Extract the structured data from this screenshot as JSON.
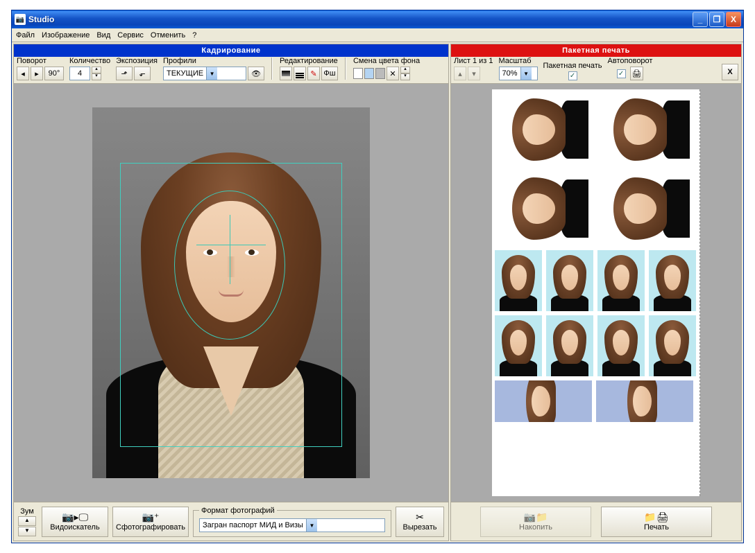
{
  "window": {
    "title": "Studio"
  },
  "menu": {
    "file": "Файл",
    "image": "Изображение",
    "view": "Вид",
    "service": "Сервис",
    "undo": "Отменить",
    "help": "?"
  },
  "left": {
    "header": "Кадрирование",
    "rotate": {
      "label": "Поворот",
      "angle": "90°"
    },
    "quantity": {
      "label": "Количество",
      "value": "4"
    },
    "exposure": {
      "label": "Экспозиция"
    },
    "profiles": {
      "label": "Профили",
      "value": "ТЕКУЩИЕ"
    },
    "editing": {
      "label": "Редактирование",
      "fs": "Фш"
    },
    "bgcolor": {
      "label": "Смена цвета фона"
    }
  },
  "bottom": {
    "zoom": "Зум",
    "viewfinder": "Видоискатель",
    "shoot": "Сфотографировать",
    "format_legend": "Формат фотографий",
    "format_value": "Загран паспорт МИД и Визы",
    "cut": "Вырезать"
  },
  "right": {
    "header": "Пакетная печать",
    "sheet": "Лист 1 из 1",
    "scale_label": "Масштаб",
    "scale_value": "70%",
    "batch_label": "Пакетная печать",
    "autorotate": "Автоповорот"
  },
  "rbottom": {
    "accumulate": "Накопить",
    "print": "Печать"
  }
}
